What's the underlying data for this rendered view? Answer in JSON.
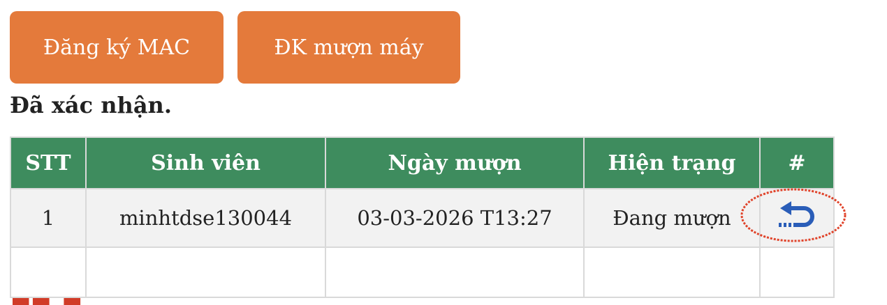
{
  "buttons": {
    "register_mac": "Đăng ký MAC",
    "register_borrow": "ĐK mượn máy"
  },
  "section": {
    "heading": "Đã xác nhận."
  },
  "table": {
    "headers": [
      "STT",
      "Sinh viên",
      "Ngày mượn",
      "Hiện trạng",
      "#"
    ],
    "rows": [
      {
        "stt": "1",
        "student": "minhtdse130044",
        "borrow_date": "03-03-2026 T13:27",
        "status": "Đang mượn",
        "action_icon": "return-icon"
      }
    ]
  },
  "colors": {
    "button": "#e47a3b",
    "header": "#3e8c5e",
    "row_bg": "#f2f2f2",
    "icon": "#2a5db8",
    "annotation": "#e0432a"
  }
}
